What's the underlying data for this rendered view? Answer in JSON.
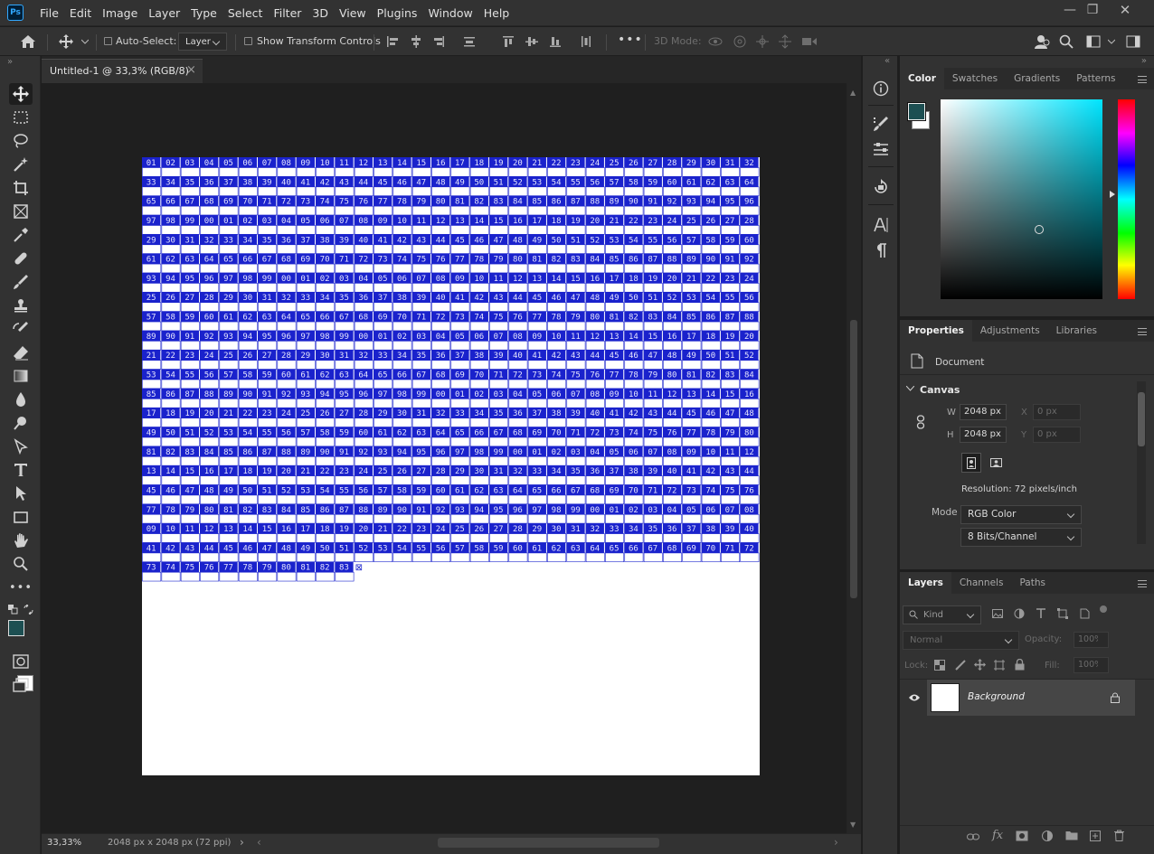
{
  "app": {
    "logo": "Ps"
  },
  "menu": [
    "File",
    "Edit",
    "Image",
    "Layer",
    "Type",
    "Select",
    "Filter",
    "3D",
    "View",
    "Plugins",
    "Window",
    "Help"
  ],
  "window_controls": {
    "minimize": "—",
    "restore": "❐",
    "close": "✕"
  },
  "options_bar": {
    "auto_select_label": "Auto-Select:",
    "auto_select_target": "Layer",
    "show_transform_label": "Show Transform Controls",
    "mode_3d_label": "3D Mode:",
    "more": "•••"
  },
  "document": {
    "tab_title": "Untitled-1 @ 33,3% (RGB/8)",
    "tab_close": "×",
    "zoom": "33,33%",
    "doc_info": "2048 px x 2048 px (72 ppi)",
    "canvas_bg": "#ffffff",
    "grid": {
      "cell_color": "#1a22cc",
      "text_color": "#e6e6ff",
      "columns": 32,
      "rows": 22,
      "last_row_cells": 11,
      "start_number": 1,
      "end_marker": "⊠"
    }
  },
  "color_panel": {
    "tabs": [
      "Color",
      "Swatches",
      "Gradients",
      "Patterns"
    ],
    "active_tab": "Color",
    "foreground": "#1d4f52",
    "background": "#ffffff",
    "hue_color": "#00e5ff"
  },
  "properties_panel": {
    "tabs": [
      "Properties",
      "Adjustments",
      "Libraries"
    ],
    "active_tab": "Properties",
    "doc_label": "Document",
    "canvas_section": "Canvas",
    "w_label": "W",
    "w_value": "2048 px",
    "h_label": "H",
    "h_value": "2048 px",
    "x_label": "X",
    "x_value": "0 px",
    "y_label": "Y",
    "y_value": "0 px",
    "resolution": "Resolution: 72 pixels/inch",
    "mode_label": "Mode",
    "mode_value": "RGB Color",
    "bits_value": "8 Bits/Channel"
  },
  "layers_panel": {
    "tabs": [
      "Layers",
      "Channels",
      "Paths"
    ],
    "active_tab": "Layers",
    "kind_filter": "Kind",
    "blend_mode": "Normal",
    "opacity_label": "Opacity:",
    "opacity_value": "100%",
    "lock_label": "Lock:",
    "fill_label": "Fill:",
    "fill_value": "100%",
    "layers": [
      {
        "name": "Background",
        "visible": true,
        "locked": true
      }
    ]
  }
}
